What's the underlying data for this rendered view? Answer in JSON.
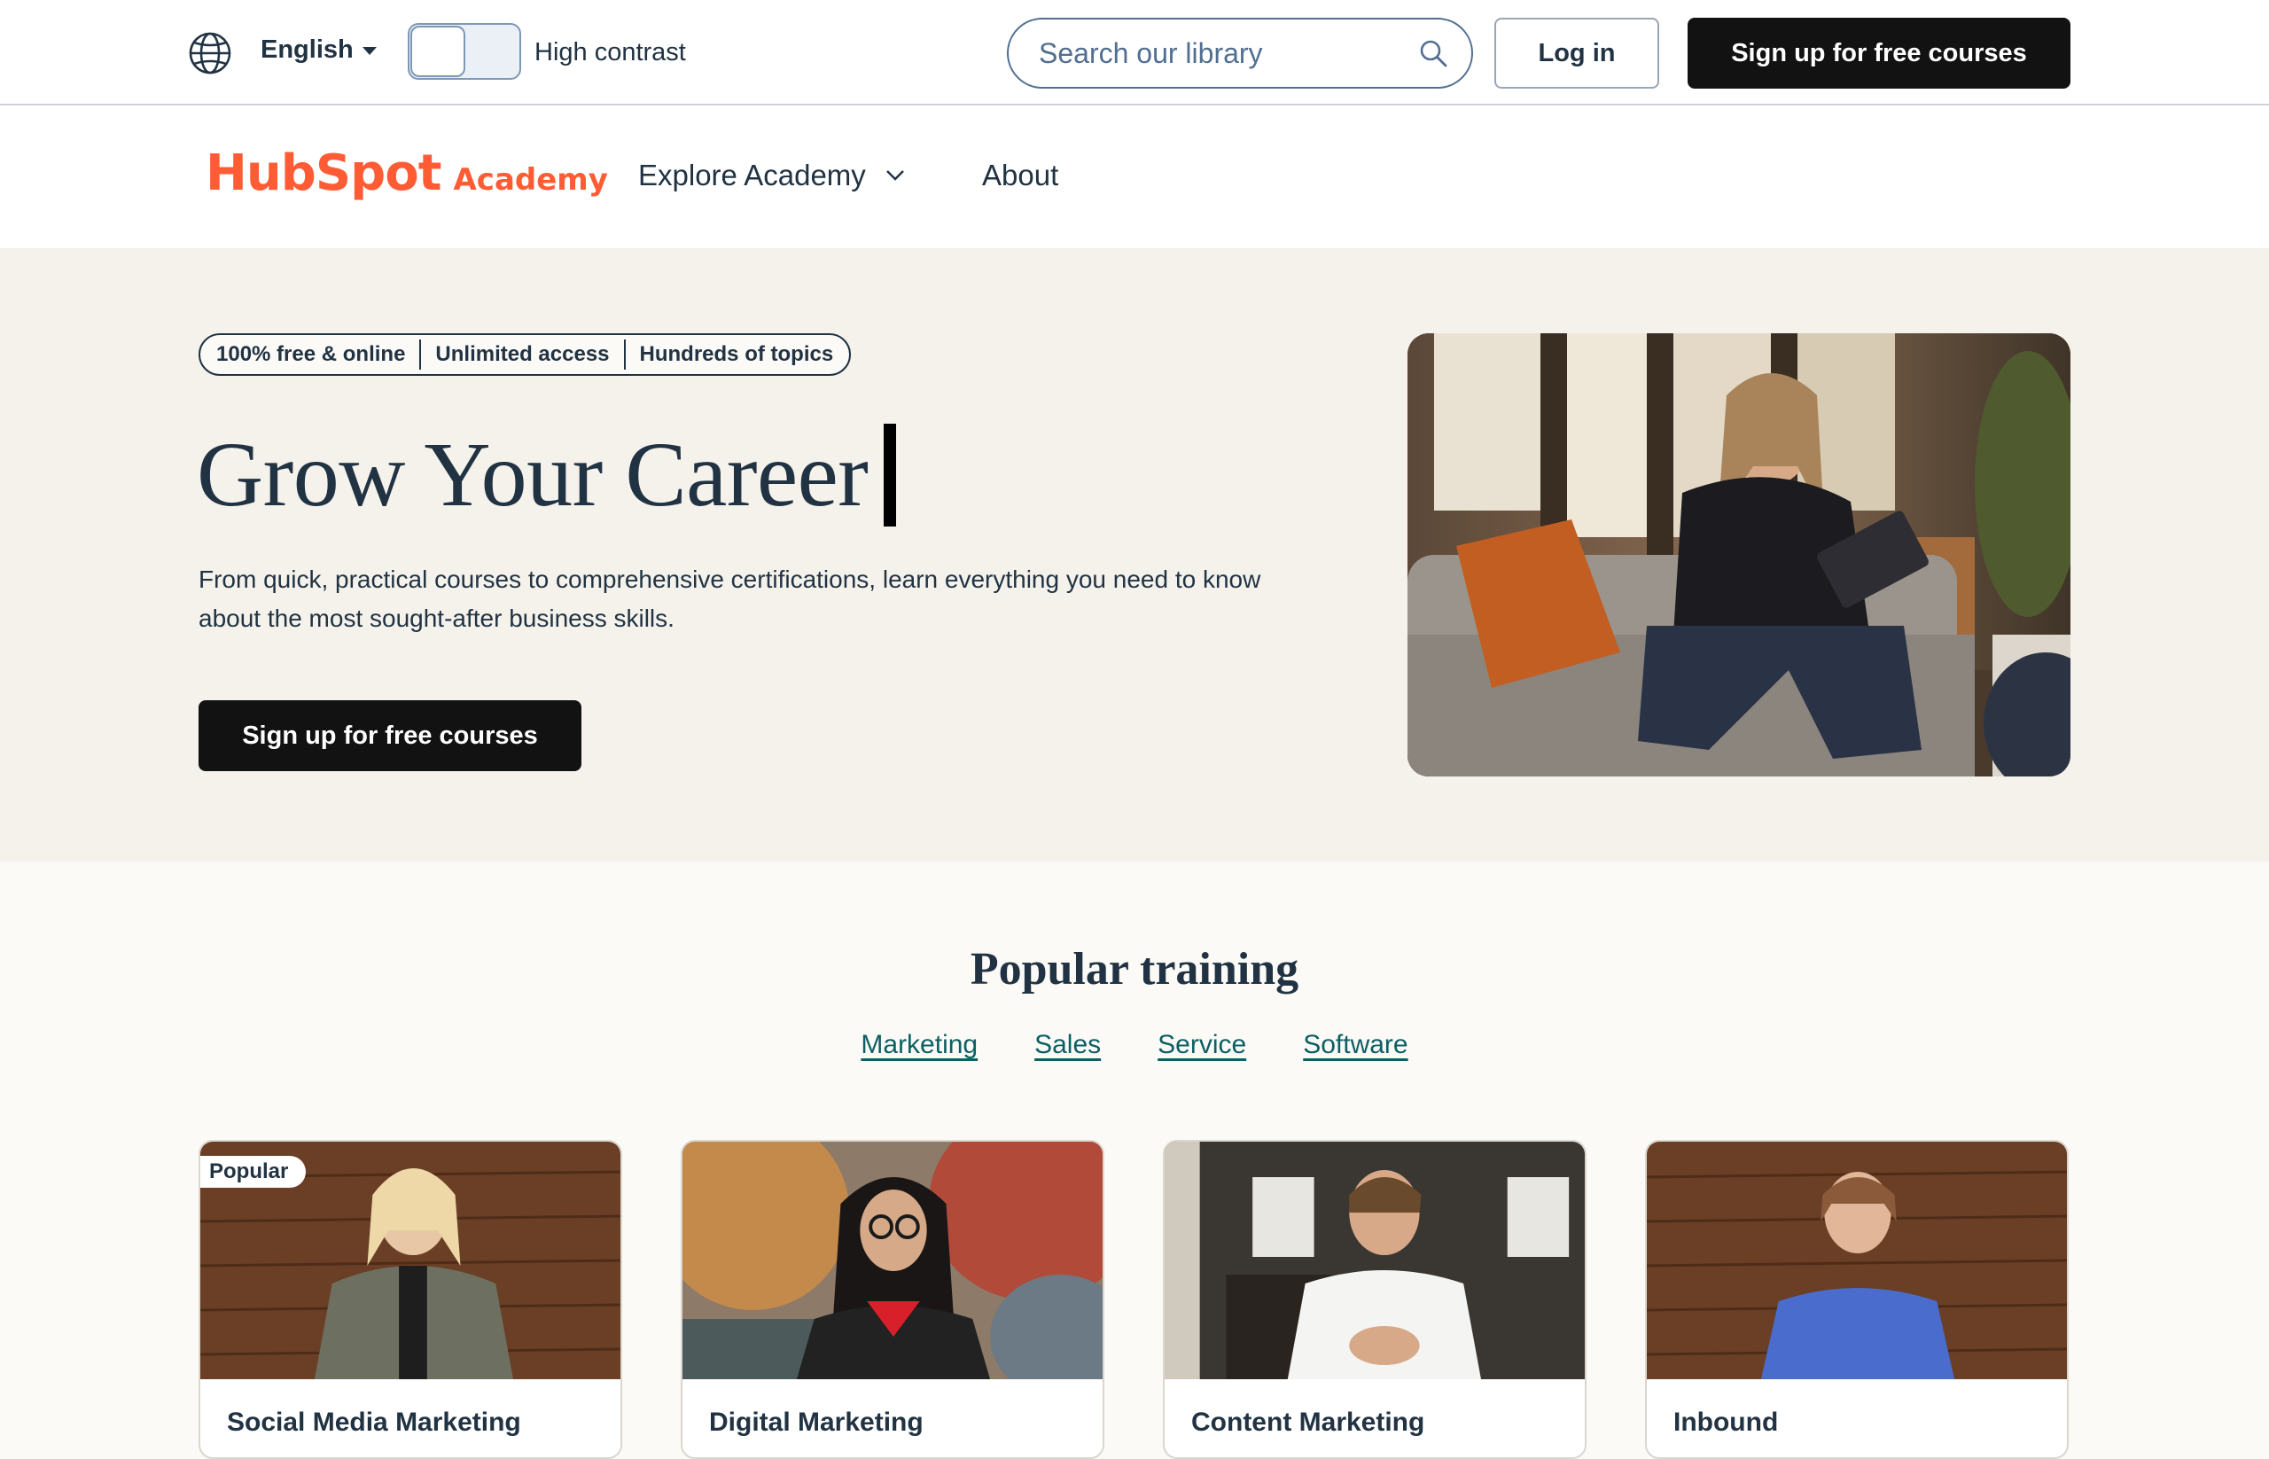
{
  "utility": {
    "language": "English",
    "high_contrast_label": "High contrast",
    "search_placeholder": "Search our library",
    "login_label": "Log in",
    "signup_label": "Sign up for free courses"
  },
  "nav": {
    "logo_hubspot": "HubSpot",
    "logo_academy": "Academy",
    "explore_label": "Explore Academy",
    "about_label": "About"
  },
  "hero": {
    "pills": [
      "100% free & online",
      "Unlimited access",
      "Hundreds of topics"
    ],
    "title": "Grow Your Career",
    "subtitle": "From quick, practical courses to comprehensive certifications, learn everything you need to know about the most sought-after business skills.",
    "cta_label": "Sign up for free courses"
  },
  "popular": {
    "title": "Popular training",
    "tabs": [
      "Marketing",
      "Sales",
      "Service",
      "Software"
    ],
    "cards": [
      {
        "badge": "Popular",
        "title": "Social Media Marketing"
      },
      {
        "badge": "",
        "title": "Digital Marketing"
      },
      {
        "badge": "",
        "title": "Content Marketing"
      },
      {
        "badge": "",
        "title": "Inbound"
      }
    ]
  },
  "colors": {
    "brand_orange": "#ff5c35",
    "text_dark": "#213343",
    "link_teal": "#0d5f63",
    "button_black": "#121212",
    "hero_bg": "#f5f2ec"
  },
  "icons": {
    "language": "globe-icon",
    "search": "search-icon",
    "explore_dropdown": "chevron-down-icon"
  }
}
